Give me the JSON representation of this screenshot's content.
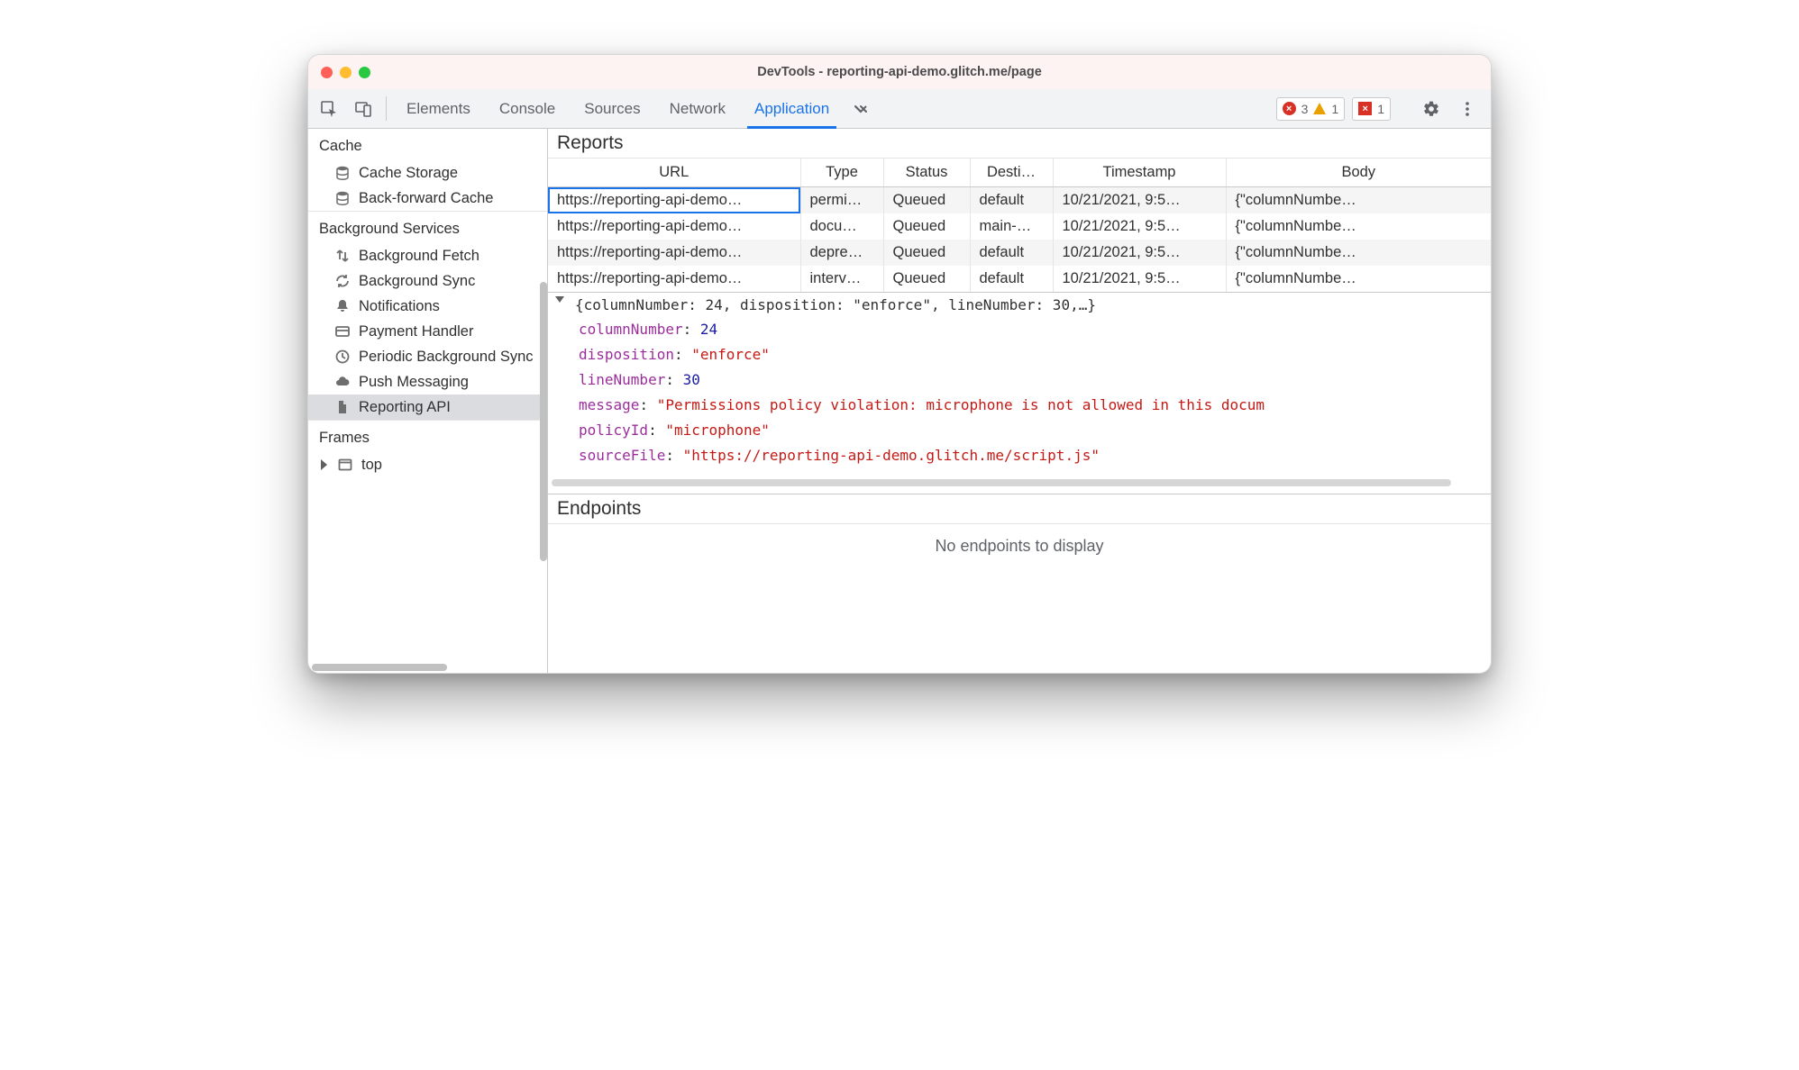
{
  "window": {
    "title": "DevTools - reporting-api-demo.glitch.me/page"
  },
  "toolbar": {
    "tabs": [
      {
        "label": "Elements"
      },
      {
        "label": "Console"
      },
      {
        "label": "Sources"
      },
      {
        "label": "Network"
      },
      {
        "label": "Application",
        "active": true
      }
    ],
    "error_count": "3",
    "warn_count": "1",
    "issue_count": "1"
  },
  "sidebar": {
    "sections": {
      "cache": {
        "title": "Cache",
        "items": [
          {
            "icon": "database",
            "label": "Cache Storage"
          },
          {
            "icon": "database",
            "label": "Back-forward Cache"
          }
        ]
      },
      "bg": {
        "title": "Background Services",
        "items": [
          {
            "icon": "swap",
            "label": "Background Fetch"
          },
          {
            "icon": "sync",
            "label": "Background Sync"
          },
          {
            "icon": "bell",
            "label": "Notifications"
          },
          {
            "icon": "card",
            "label": "Payment Handler"
          },
          {
            "icon": "clock",
            "label": "Periodic Background Sync"
          },
          {
            "icon": "cloud",
            "label": "Push Messaging"
          },
          {
            "icon": "file",
            "label": "Reporting API",
            "selected": true
          }
        ]
      },
      "frames": {
        "title": "Frames",
        "items": [
          {
            "icon": "frame",
            "label": "top",
            "expandable": true
          }
        ]
      }
    }
  },
  "reports": {
    "title": "Reports",
    "columns": [
      {
        "key": "url",
        "label": "URL"
      },
      {
        "key": "type",
        "label": "Type"
      },
      {
        "key": "status",
        "label": "Status"
      },
      {
        "key": "dest",
        "label": "Desti…"
      },
      {
        "key": "timestamp",
        "label": "Timestamp"
      },
      {
        "key": "body",
        "label": "Body"
      }
    ],
    "rows": [
      {
        "url": "https://reporting-api-demo…",
        "type": "permi…",
        "status": "Queued",
        "dest": "default",
        "timestamp": "10/21/2021, 9:5…",
        "body": "{\"columnNumbe…",
        "selected": true
      },
      {
        "url": "https://reporting-api-demo…",
        "type": "docu…",
        "status": "Queued",
        "dest": "main-…",
        "timestamp": "10/21/2021, 9:5…",
        "body": "{\"columnNumbe…"
      },
      {
        "url": "https://reporting-api-demo…",
        "type": "depre…",
        "status": "Queued",
        "dest": "default",
        "timestamp": "10/21/2021, 9:5…",
        "body": "{\"columnNumbe…"
      },
      {
        "url": "https://reporting-api-demo…",
        "type": "interv…",
        "status": "Queued",
        "dest": "default",
        "timestamp": "10/21/2021, 9:5…",
        "body": "{\"columnNumbe…"
      }
    ]
  },
  "detail": {
    "header": "{columnNumber: 24, disposition: \"enforce\", lineNumber: 30,…}",
    "props": {
      "columnNumber_k": "columnNumber",
      "columnNumber_v": "24",
      "disposition_k": "disposition",
      "disposition_v": "\"enforce\"",
      "lineNumber_k": "lineNumber",
      "lineNumber_v": "30",
      "message_k": "message",
      "message_v": "\"Permissions policy violation: microphone is not allowed in this docum",
      "policyId_k": "policyId",
      "policyId_v": "\"microphone\"",
      "sourceFile_k": "sourceFile",
      "sourceFile_v": "\"https://reporting-api-demo.glitch.me/script.js\""
    }
  },
  "endpoints": {
    "title": "Endpoints",
    "empty": "No endpoints to display"
  }
}
